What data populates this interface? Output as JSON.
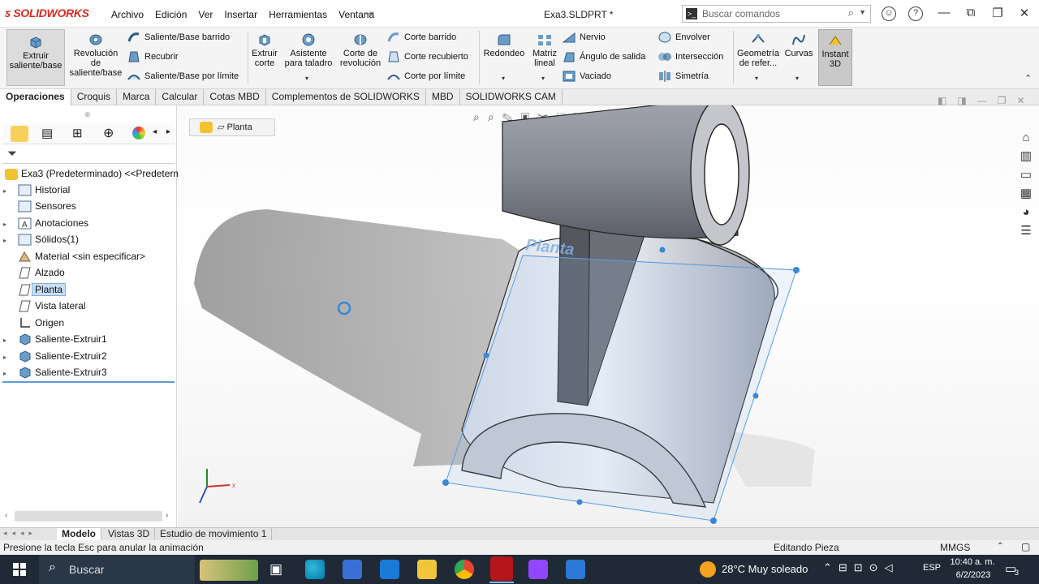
{
  "app": {
    "logo": "SOLIDWORKS",
    "document_title": "Exa3.SLDPRT *"
  },
  "menu": [
    "Archivo",
    "Edición",
    "Ver",
    "Insertar",
    "Herramientas",
    "Ventana"
  ],
  "search": {
    "placeholder": "Buscar comandos"
  },
  "ribbon": {
    "extrude": "Extruir saliente/base",
    "revolve": "Revolución de saliente/base",
    "sweep": "Saliente/Base barrido",
    "loft": "Recubrir",
    "boundary": "Saliente/Base por límite",
    "extrude_cut": "Extruir corte",
    "hole_wizard": "Asistente para taladro",
    "revolve_cut": "Corte de revolución",
    "swept_cut": "Corte barrido",
    "lofted_cut": "Corte recubierto",
    "boundary_cut": "Corte por límite",
    "fillet": "Redondeo",
    "pattern": "Matriz lineal",
    "rib": "Nervio",
    "draft": "Ángulo de salida",
    "shell": "Vaciado",
    "wrap": "Envolver",
    "intersect": "Intersección",
    "mirror": "Simetría",
    "ref_geometry": "Geometría de refer...",
    "curves": "Curvas",
    "instant3d": "Instant 3D"
  },
  "tabs": [
    "Operaciones",
    "Croquis",
    "Marca",
    "Calcular",
    "Cotas MBD",
    "Complementos de SOLIDWORKS",
    "MBD",
    "SOLIDWORKS CAM"
  ],
  "tree": {
    "root": "Exa3  (Predeterminado) <<Predetermin",
    "items": [
      {
        "label": "Historial",
        "icon": "history-icon",
        "expand": true
      },
      {
        "label": "Sensores",
        "icon": "sensor-icon",
        "expand": false
      },
      {
        "label": "Anotaciones",
        "icon": "annotation-icon",
        "expand": true
      },
      {
        "label": "Sólidos(1)",
        "icon": "solid-bodies-icon",
        "expand": true
      },
      {
        "label": "Material <sin especificar>",
        "icon": "material-icon",
        "expand": false
      },
      {
        "label": "Alzado",
        "icon": "plane-icon",
        "expand": false
      },
      {
        "label": "Planta",
        "icon": "plane-icon",
        "expand": false,
        "selected": true
      },
      {
        "label": "Vista lateral",
        "icon": "plane-icon",
        "expand": false
      },
      {
        "label": "Origen",
        "icon": "origin-icon",
        "expand": false
      },
      {
        "label": "Saliente-Extruir1",
        "icon": "extrude-feature-icon",
        "expand": true
      },
      {
        "label": "Saliente-Extruir2",
        "icon": "extrude-feature-icon",
        "expand": true
      },
      {
        "label": "Saliente-Extruir3",
        "icon": "extrude-feature-icon",
        "expand": true
      }
    ]
  },
  "viewport": {
    "breadcrumb": "Planta",
    "plane_label": "Planta",
    "axis_x": "x"
  },
  "bottom_tabs": [
    "Modelo",
    "Vistas 3D",
    "Estudio de movimiento 1"
  ],
  "status": {
    "message": "Presione la tecla Esc para anular la animación",
    "mode": "Editando Pieza",
    "units": "MMGS"
  },
  "taskbar": {
    "search": "Buscar",
    "weather": "28°C  Muy soleado",
    "lang": "ESP",
    "time": "10:40 a. m.",
    "date": "6/2/2023",
    "notifications": "3"
  }
}
